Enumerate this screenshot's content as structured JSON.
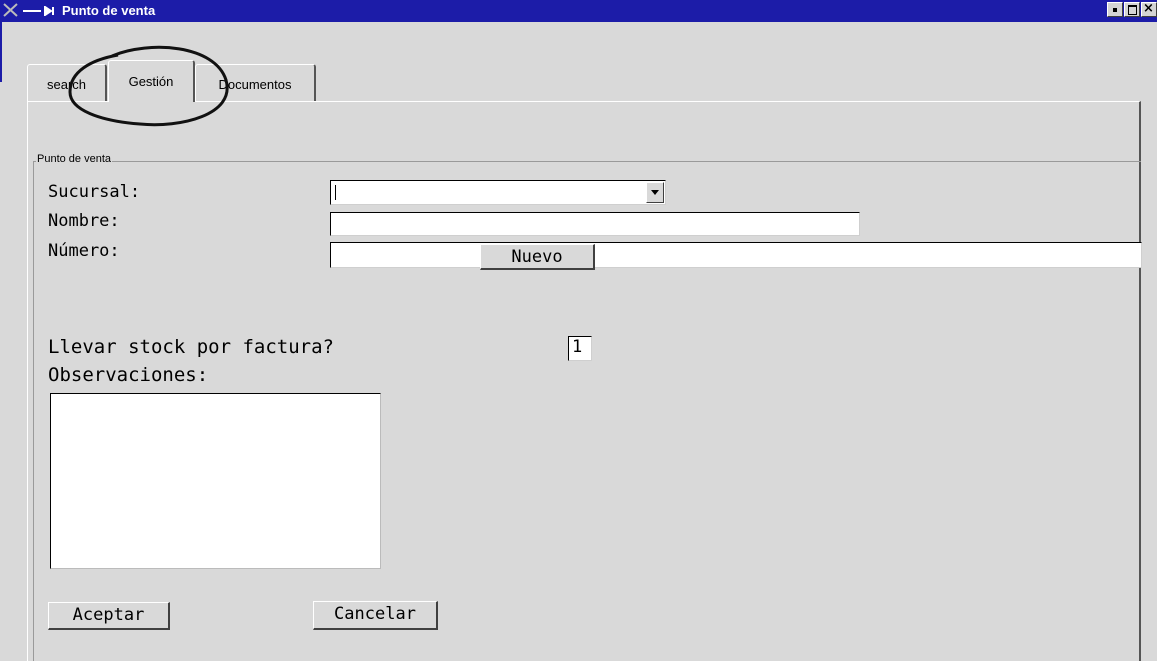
{
  "window": {
    "title": "Punto de venta",
    "title_bar_color": "#1c1ca8",
    "icons": [
      "app-icon",
      "minimize-icon",
      "maximize-icon",
      "close-icon"
    ]
  },
  "tabs": [
    {
      "label": "search",
      "active": false
    },
    {
      "label": "Gestión",
      "active": true
    },
    {
      "label": "Documentos",
      "active": false
    }
  ],
  "form": {
    "group_label": "Punto de venta",
    "sucursal_label": "Sucursal:",
    "sucursal_value": "",
    "nombre_label": "Nombre:",
    "nombre_value": "",
    "numero_label": "Número:",
    "numero_value": "",
    "nuevo_button": "Nuevo",
    "stock_label": "Llevar stock por factura?",
    "stock_value": "1",
    "observaciones_label": "Observaciones:",
    "observaciones_value": "",
    "aceptar_button": "Aceptar",
    "cancelar_button": "Cancelar"
  }
}
